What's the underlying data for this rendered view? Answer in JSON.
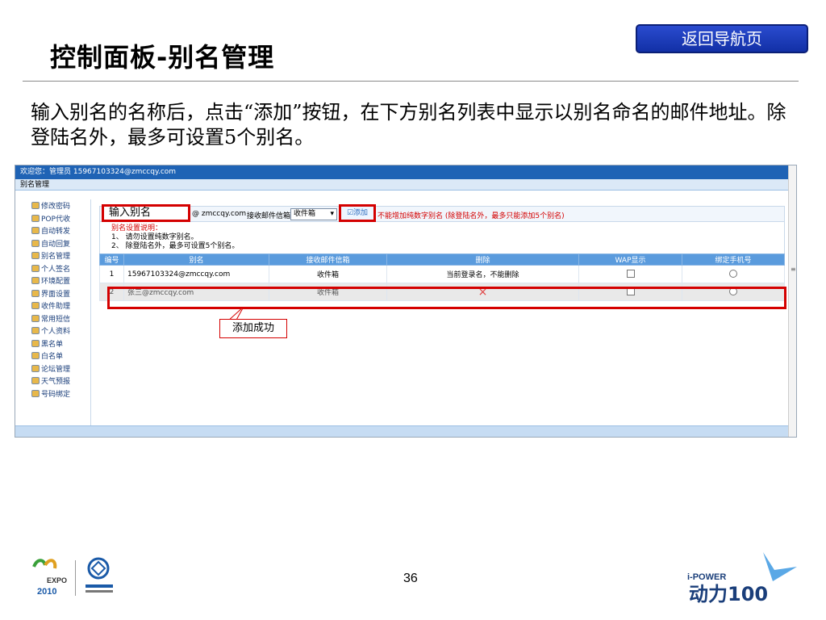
{
  "slide": {
    "title": "控制面板-别名管理",
    "nav_button": "返回导航页",
    "description": "输入别名的名称后，点击“添加”按钮，在下方别名列表中显示以别名命名的邮件地址。除登陆名外，最多可设置5个别名。",
    "page_number": "36"
  },
  "screenshot": {
    "welcome": "欢迎您：管理员 15967103324@zmccqy.com",
    "section": "别名管理",
    "sidebar": [
      "修改密码",
      "POP代收",
      "自动转发",
      "自动回复",
      "别名管理",
      "个人签名",
      "环境配置",
      "界面设置",
      "收件助理",
      "常用短信",
      "个人资料",
      "黑名单",
      "白名单",
      "论坛管理",
      "天气预报",
      "号码绑定"
    ],
    "input_value": "输入别名",
    "domain": "@ zmccqy.com",
    "box_label": "接收邮件信箱",
    "select_value": "收件箱",
    "add_button": "添加",
    "warning": "不能增加纯数字别名 (除登陆名外，最多只能添加5个别名)",
    "notes_title": "别名设置说明：",
    "notes": [
      "1、 请勿设置纯数字别名。",
      "2、 除登陆名外，最多可设置5个别名。"
    ],
    "columns": [
      "编号",
      "别名",
      "接收邮件信箱",
      "删除",
      "WAP显示",
      "绑定手机号"
    ],
    "rows": [
      {
        "no": "1",
        "alias": "15967103324@zmccqy.com",
        "box": "收件箱",
        "del": "当前登录名，不能删除"
      },
      {
        "no": "2",
        "alias": "张三@zmccqy.com",
        "box": "收件箱",
        "del": "×"
      }
    ],
    "callout": "添加成功"
  },
  "colors": {
    "nav_button": "#1a3cbf",
    "header_bar": "#1f63b5",
    "highlight": "#d40000",
    "table_header": "#5a9bdd"
  },
  "footer": {
    "left_logos": [
      "expo-2010-logo",
      "china-mobile-logo"
    ],
    "right_logo_text": "i-POWER 动力100"
  }
}
